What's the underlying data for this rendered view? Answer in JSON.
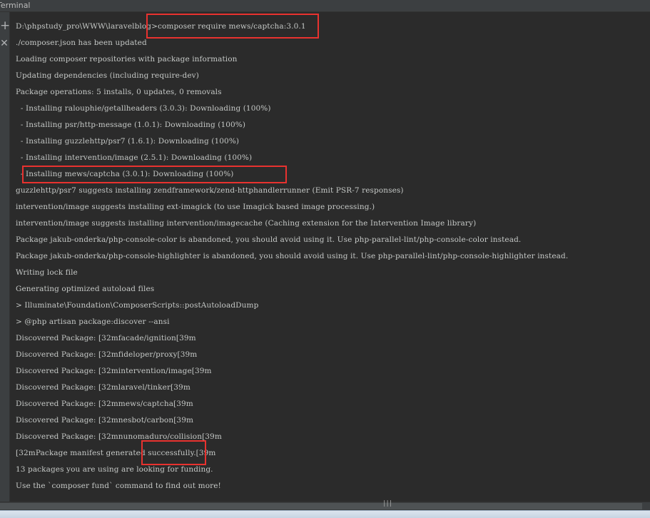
{
  "window": {
    "title": "Terminal"
  },
  "toolbar": {
    "add_label": "+",
    "close_label": "✕"
  },
  "terminal": {
    "lines": [
      "D:\\phpstudy_pro\\WWW\\laravelblog>composer require mews/captcha:3.0.1",
      "./composer.json has been updated",
      "Loading composer repositories with package information",
      "Updating dependencies (including require-dev)",
      "Package operations: 5 installs, 0 updates, 0 removals",
      "  - Installing ralouphie/getallheaders (3.0.3): Downloading (100%)",
      "  - Installing psr/http-message (1.0.1): Downloading (100%)",
      "  - Installing guzzlehttp/psr7 (1.6.1): Downloading (100%)",
      "  - Installing intervention/image (2.5.1): Downloading (100%)",
      "  - Installing mews/captcha (3.0.1): Downloading (100%)",
      "guzzlehttp/psr7 suggests installing zendframework/zend-httphandlerrunner (Emit PSR-7 responses)",
      "intervention/image suggests installing ext-imagick (to use Imagick based image processing.)",
      "intervention/image suggests installing intervention/imagecache (Caching extension for the Intervention Image library)",
      "Package jakub-onderka/php-console-color is abandoned, you should avoid using it. Use php-parallel-lint/php-console-color instead.",
      "Package jakub-onderka/php-console-highlighter is abandoned, you should avoid using it. Use php-parallel-lint/php-console-highlighter instead.",
      "Writing lock file",
      "Generating optimized autoload files",
      "> Illuminate\\Foundation\\ComposerScripts::postAutoloadDump",
      "> @php artisan package:discover --ansi",
      "Discovered Package: [32mfacade/ignition[39m",
      "Discovered Package: [32mfideloper/proxy[39m",
      "Discovered Package: [32mintervention/image[39m",
      "Discovered Package: [32mlaravel/tinker[39m",
      "Discovered Package: [32mmews/captcha[39m",
      "Discovered Package: [32mnesbot/carbon[39m",
      "Discovered Package: [32mnunomaduro/collision[39m",
      "[32mPackage manifest generated successfully.[39m",
      "13 packages you are using are looking for funding.",
      "Use the `composer fund` command to find out more!"
    ]
  },
  "scrollbar": {
    "grip": "|||"
  },
  "colors": {
    "background": "#2b2b2b",
    "text": "#c5c8c6",
    "highlight_box": "#e8322f"
  }
}
